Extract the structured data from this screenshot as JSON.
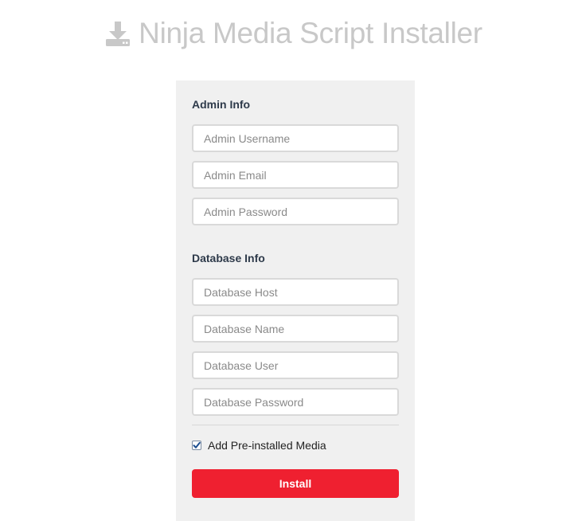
{
  "header": {
    "icon": "download-icon",
    "title": "Ninja Media Script Installer"
  },
  "admin": {
    "title": "Admin Info",
    "username_placeholder": "Admin Username",
    "email_placeholder": "Admin Email",
    "password_placeholder": "Admin Password"
  },
  "database": {
    "title": "Database Info",
    "host_placeholder": "Database Host",
    "name_placeholder": "Database Name",
    "user_placeholder": "Database User",
    "password_placeholder": "Database Password"
  },
  "options": {
    "preinstalled_label": "Add Pre-installed Media",
    "preinstalled_checked": true
  },
  "install_label": "Install",
  "colors": {
    "header_text": "#c8c8c8",
    "panel_bg": "#f0f0f0",
    "button_bg": "#ef2030",
    "checkbox_check": "#1a4d8f"
  }
}
